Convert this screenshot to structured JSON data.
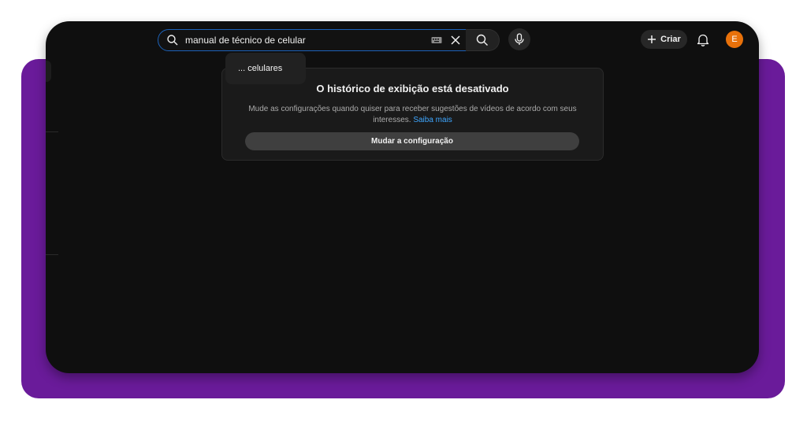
{
  "search": {
    "value": "manual de técnico de celular"
  },
  "suggestion": {
    "text": "... celulares"
  },
  "header": {
    "create_label": "Criar",
    "avatar_letter": "E"
  },
  "history_notice": {
    "title": "O histórico de exibição está desativado",
    "description": "Mude as configurações quando quiser para receber sugestões de vídeos de acordo com seus interesses.",
    "learn_more": "Saiba mais",
    "button_label": "Mudar a configuração"
  },
  "colors": {
    "frame_purple": "#6a1b9a",
    "background": "#0f0f0f",
    "accent_blue": "#3ea6ff",
    "avatar": "#e8710a"
  },
  "icons": [
    "search-icon",
    "keyboard-icon",
    "close-icon",
    "mic-icon",
    "plus-icon",
    "bell-icon"
  ]
}
